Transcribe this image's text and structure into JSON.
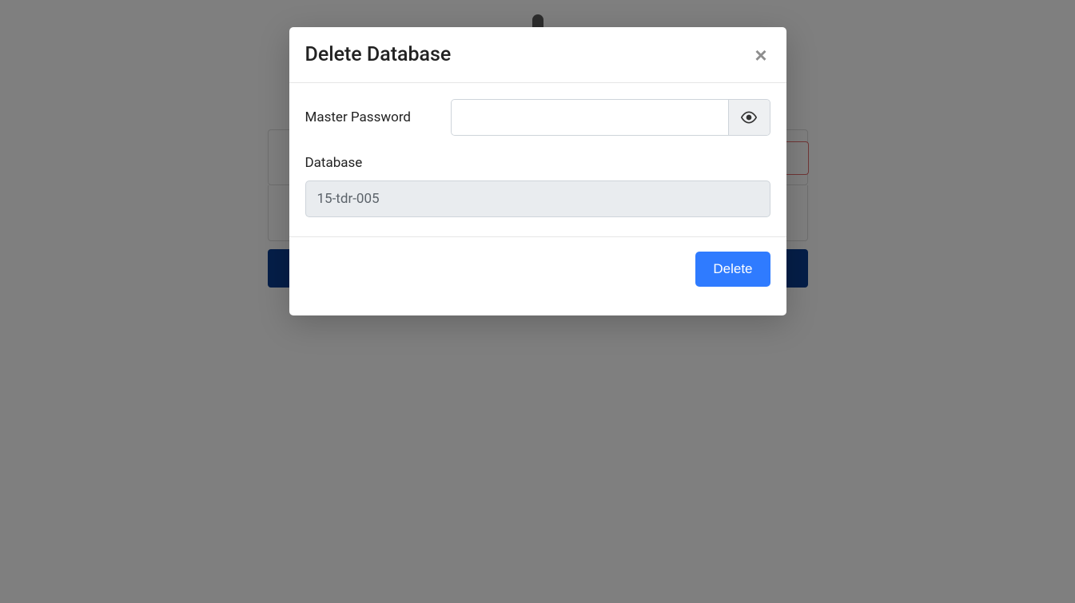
{
  "modal": {
    "title": "Delete Database",
    "master_password_label": "Master Password",
    "master_password_value": "",
    "database_label": "Database",
    "database_value": "15-tdr-005",
    "delete_label": "Delete"
  }
}
